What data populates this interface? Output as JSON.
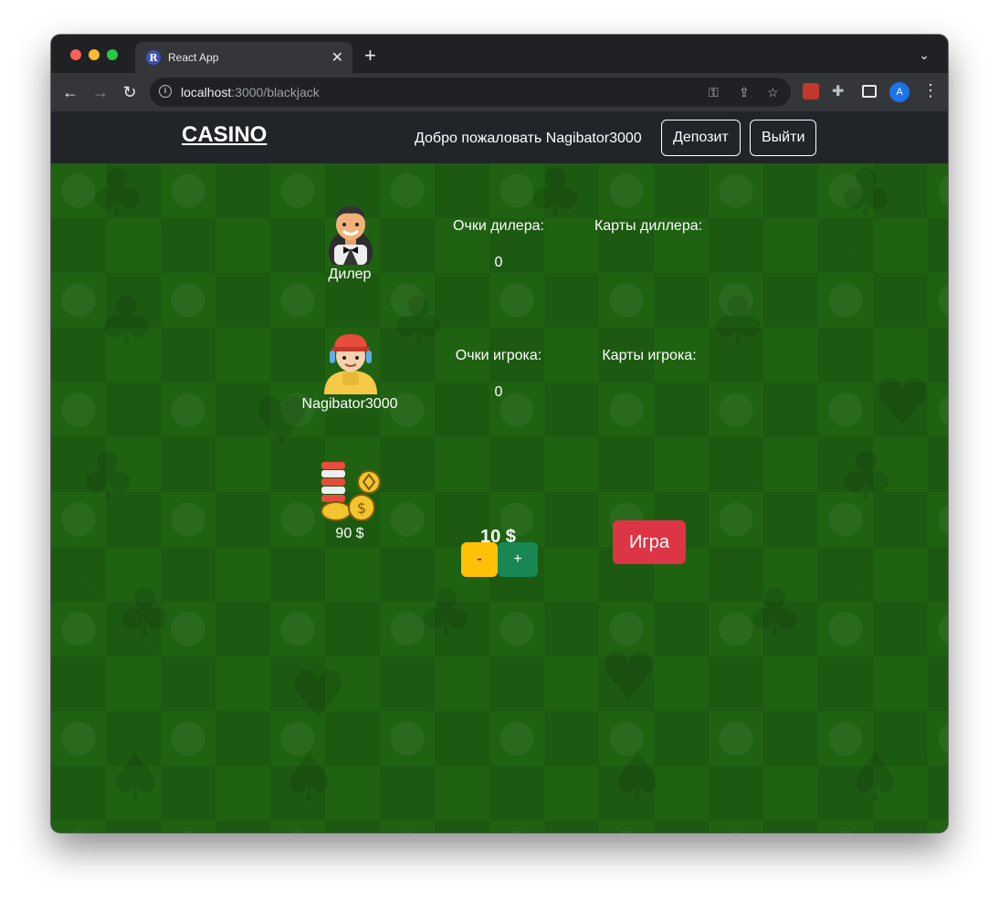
{
  "browser": {
    "tab_title": "React App",
    "tab_favicon_letter": "R",
    "url_host": "localhost",
    "url_path": ":3000/blackjack",
    "profile_initial": "A"
  },
  "navbar": {
    "brand": "CASINO",
    "welcome": "Добро пожаловать Nagibator3000",
    "deposit_label": "Депозит",
    "logout_label": "Выйти"
  },
  "dealer": {
    "name": "Дилер",
    "points_label": "Очки дилера:",
    "points_value": "0",
    "cards_label": "Карты диллера:"
  },
  "player": {
    "name": "Nagibator3000",
    "points_label": "Очки игрока:",
    "points_value": "0",
    "cards_label": "Карты игрока:"
  },
  "wallet": {
    "balance": "90 $",
    "bet": "10 $",
    "minus_label": "-",
    "plus_label": "+",
    "play_label": "Игра"
  },
  "colors": {
    "felt": "#1f6212",
    "navbar": "#212529",
    "play_button": "#dc3545",
    "minus_button": "#ffc107",
    "plus_button": "#198754"
  }
}
